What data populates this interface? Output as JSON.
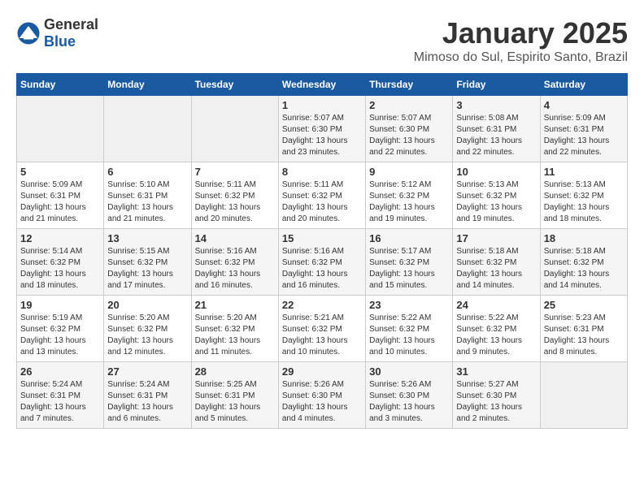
{
  "header": {
    "logo_general": "General",
    "logo_blue": "Blue",
    "month_title": "January 2025",
    "location": "Mimoso do Sul, Espirito Santo, Brazil"
  },
  "days_of_week": [
    "Sunday",
    "Monday",
    "Tuesday",
    "Wednesday",
    "Thursday",
    "Friday",
    "Saturday"
  ],
  "weeks": [
    [
      {
        "day": "",
        "info": ""
      },
      {
        "day": "",
        "info": ""
      },
      {
        "day": "",
        "info": ""
      },
      {
        "day": "1",
        "info": "Sunrise: 5:07 AM\nSunset: 6:30 PM\nDaylight: 13 hours and 23 minutes."
      },
      {
        "day": "2",
        "info": "Sunrise: 5:07 AM\nSunset: 6:30 PM\nDaylight: 13 hours and 22 minutes."
      },
      {
        "day": "3",
        "info": "Sunrise: 5:08 AM\nSunset: 6:31 PM\nDaylight: 13 hours and 22 minutes."
      },
      {
        "day": "4",
        "info": "Sunrise: 5:09 AM\nSunset: 6:31 PM\nDaylight: 13 hours and 22 minutes."
      }
    ],
    [
      {
        "day": "5",
        "info": "Sunrise: 5:09 AM\nSunset: 6:31 PM\nDaylight: 13 hours and 21 minutes."
      },
      {
        "day": "6",
        "info": "Sunrise: 5:10 AM\nSunset: 6:31 PM\nDaylight: 13 hours and 21 minutes."
      },
      {
        "day": "7",
        "info": "Sunrise: 5:11 AM\nSunset: 6:32 PM\nDaylight: 13 hours and 20 minutes."
      },
      {
        "day": "8",
        "info": "Sunrise: 5:11 AM\nSunset: 6:32 PM\nDaylight: 13 hours and 20 minutes."
      },
      {
        "day": "9",
        "info": "Sunrise: 5:12 AM\nSunset: 6:32 PM\nDaylight: 13 hours and 19 minutes."
      },
      {
        "day": "10",
        "info": "Sunrise: 5:13 AM\nSunset: 6:32 PM\nDaylight: 13 hours and 19 minutes."
      },
      {
        "day": "11",
        "info": "Sunrise: 5:13 AM\nSunset: 6:32 PM\nDaylight: 13 hours and 18 minutes."
      }
    ],
    [
      {
        "day": "12",
        "info": "Sunrise: 5:14 AM\nSunset: 6:32 PM\nDaylight: 13 hours and 18 minutes."
      },
      {
        "day": "13",
        "info": "Sunrise: 5:15 AM\nSunset: 6:32 PM\nDaylight: 13 hours and 17 minutes."
      },
      {
        "day": "14",
        "info": "Sunrise: 5:16 AM\nSunset: 6:32 PM\nDaylight: 13 hours and 16 minutes."
      },
      {
        "day": "15",
        "info": "Sunrise: 5:16 AM\nSunset: 6:32 PM\nDaylight: 13 hours and 16 minutes."
      },
      {
        "day": "16",
        "info": "Sunrise: 5:17 AM\nSunset: 6:32 PM\nDaylight: 13 hours and 15 minutes."
      },
      {
        "day": "17",
        "info": "Sunrise: 5:18 AM\nSunset: 6:32 PM\nDaylight: 13 hours and 14 minutes."
      },
      {
        "day": "18",
        "info": "Sunrise: 5:18 AM\nSunset: 6:32 PM\nDaylight: 13 hours and 14 minutes."
      }
    ],
    [
      {
        "day": "19",
        "info": "Sunrise: 5:19 AM\nSunset: 6:32 PM\nDaylight: 13 hours and 13 minutes."
      },
      {
        "day": "20",
        "info": "Sunrise: 5:20 AM\nSunset: 6:32 PM\nDaylight: 13 hours and 12 minutes."
      },
      {
        "day": "21",
        "info": "Sunrise: 5:20 AM\nSunset: 6:32 PM\nDaylight: 13 hours and 11 minutes."
      },
      {
        "day": "22",
        "info": "Sunrise: 5:21 AM\nSunset: 6:32 PM\nDaylight: 13 hours and 10 minutes."
      },
      {
        "day": "23",
        "info": "Sunrise: 5:22 AM\nSunset: 6:32 PM\nDaylight: 13 hours and 10 minutes."
      },
      {
        "day": "24",
        "info": "Sunrise: 5:22 AM\nSunset: 6:32 PM\nDaylight: 13 hours and 9 minutes."
      },
      {
        "day": "25",
        "info": "Sunrise: 5:23 AM\nSunset: 6:31 PM\nDaylight: 13 hours and 8 minutes."
      }
    ],
    [
      {
        "day": "26",
        "info": "Sunrise: 5:24 AM\nSunset: 6:31 PM\nDaylight: 13 hours and 7 minutes."
      },
      {
        "day": "27",
        "info": "Sunrise: 5:24 AM\nSunset: 6:31 PM\nDaylight: 13 hours and 6 minutes."
      },
      {
        "day": "28",
        "info": "Sunrise: 5:25 AM\nSunset: 6:31 PM\nDaylight: 13 hours and 5 minutes."
      },
      {
        "day": "29",
        "info": "Sunrise: 5:26 AM\nSunset: 6:30 PM\nDaylight: 13 hours and 4 minutes."
      },
      {
        "day": "30",
        "info": "Sunrise: 5:26 AM\nSunset: 6:30 PM\nDaylight: 13 hours and 3 minutes."
      },
      {
        "day": "31",
        "info": "Sunrise: 5:27 AM\nSunset: 6:30 PM\nDaylight: 13 hours and 2 minutes."
      },
      {
        "day": "",
        "info": ""
      }
    ]
  ]
}
